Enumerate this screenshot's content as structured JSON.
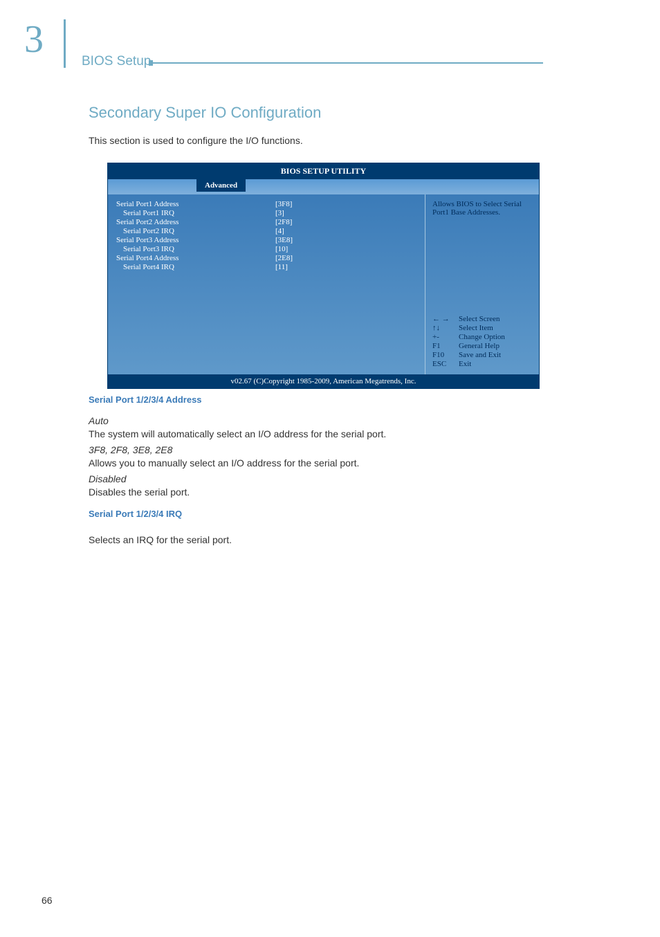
{
  "chapter": {
    "number": "3",
    "label": "BIOS Setup"
  },
  "section_title": "Secondary Super IO Configuration",
  "intro_text": "This section is used to configure the I/O functions.",
  "bios": {
    "title": "BIOS SETUP UTILITY",
    "active_tab": "Advanced",
    "settings": [
      {
        "label": "Serial Port1 Address",
        "value": "[3F8]",
        "indented": false
      },
      {
        "label": "Serial Port1 IRQ",
        "value": "[3]",
        "indented": true
      },
      {
        "label": "Serial Port2 Address",
        "value": "[2F8]",
        "indented": false
      },
      {
        "label": "Serial Port2 IRQ",
        "value": "[4]",
        "indented": true
      },
      {
        "label": "Serial Port3 Address",
        "value": "[3E8]",
        "indented": false
      },
      {
        "label": "Serial Port3 IRQ",
        "value": "[10]",
        "indented": true
      },
      {
        "label": "Serial Port4 Address",
        "value": "[2E8]",
        "indented": false
      },
      {
        "label": "Serial Port4 IRQ",
        "value": "[11]",
        "indented": true
      }
    ],
    "help_text": "Allows BIOS to Select Serial Port1 Base Addresses.",
    "keys": [
      {
        "sym": "← →",
        "desc": "Select Screen"
      },
      {
        "sym": "↑↓",
        "desc": "Select Item"
      },
      {
        "sym": "+-",
        "desc": "Change Option"
      },
      {
        "sym": "F1",
        "desc": "General Help"
      },
      {
        "sym": "F10",
        "desc": "Save and Exit"
      },
      {
        "sym": "ESC",
        "desc": "Exit"
      }
    ],
    "copyright": "v02.67 (C)Copyright 1985-2009, American Megatrends, Inc."
  },
  "headings": {
    "address": "Serial Port 1/2/3/4 Address",
    "irq": "Serial Port 1/2/3/4 IRQ"
  },
  "content": {
    "auto_label": "Auto",
    "auto_desc": "The system will automatically select an I/O address for the serial port.",
    "addr_label": "3F8, 2F8, 3E8, 2E8",
    "addr_desc": "Allows you to manually select an I/O address for the serial port.",
    "disabled_label": "Disabled",
    "disabled_desc": "Disables the serial port.",
    "irq_desc": "Selects an IRQ for the serial port."
  },
  "page_number": "66"
}
